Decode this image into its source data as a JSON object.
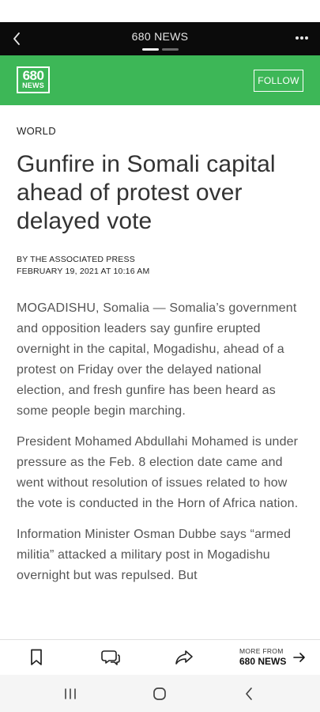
{
  "topbar": {
    "title": "680 NEWS",
    "back_icon": "chevron-left-icon",
    "menu_icon": "more-horizontal-icon",
    "pager_pages": 2,
    "pager_active": 1
  },
  "brand": {
    "logo_number": "680",
    "logo_word": "NEWS",
    "follow_label": "FOLLOW",
    "color": "#3db757"
  },
  "article": {
    "section": "WORLD",
    "headline": "Gunfire in Somali capital ahead of protest over delayed vote",
    "byline": "BY THE ASSOCIATED PRESS",
    "date": "FEBRUARY 19, 2021 AT 10:16 AM",
    "paragraphs": [
      "MOGADISHU, Somalia — Somalia’s government and opposition leaders say gunfire erupted overnight in the capital, Mogadishu, ahead of a protest on Friday over the delayed national election, and fresh gunfire has been heard as some people begin marching.",
      "President Mohamed Abdullahi Mohamed is under pressure as the Feb. 8 election date came and went without resolution of issues related to how the vote is conducted in the Horn of Africa nation.",
      "Information Minister Osman Dubbe says “armed militia” attacked a military post in Mogadishu overnight but was repulsed. But"
    ]
  },
  "bottombar": {
    "icons": [
      "bookmark-icon",
      "comment-icon",
      "share-icon"
    ],
    "more_from_label": "MORE FROM",
    "more_from_source": "680 NEWS"
  },
  "system_nav": {
    "icons": [
      "recent-apps-icon",
      "home-icon",
      "back-icon"
    ]
  }
}
